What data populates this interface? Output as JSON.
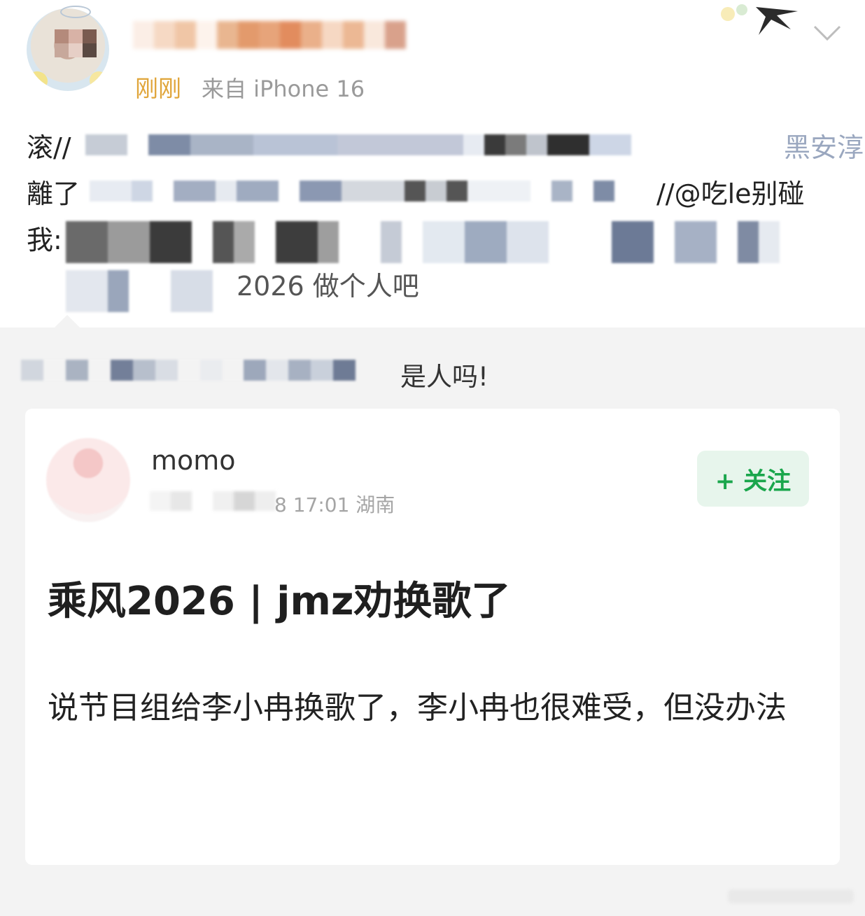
{
  "post": {
    "timestamp": "刚刚",
    "source": "来自 iPhone 16",
    "text_lines": [
      {
        "prefix": "滚//",
        "visible_tail": "黑安淳"
      },
      {
        "prefix": "離了",
        "visible_tail": "//@吃le别碰"
      },
      {
        "prefix": "我:",
        "visible_tail": ""
      },
      {
        "prefix": "",
        "visible_tail": "2026 做个人吧"
      }
    ]
  },
  "repost": {
    "comment": "是人吗!",
    "card": {
      "username": "momo",
      "meta": "8 17:01 湖南",
      "follow_label": "+ 关注",
      "title": "乘风2026 | jmz劝换歌了",
      "body": "说节目组给李小冉换歌了，李小冉也很难受，但没办法"
    }
  },
  "icons": {
    "menu": "chevron-down-icon",
    "decoration": "swallow-icon"
  },
  "colors": {
    "timestamp": "#e0a53a",
    "mention": "#5b78a8",
    "follow": "#1aa64c",
    "follow_bg": "#e7f5ec",
    "repost_bg": "#f3f3f3"
  }
}
